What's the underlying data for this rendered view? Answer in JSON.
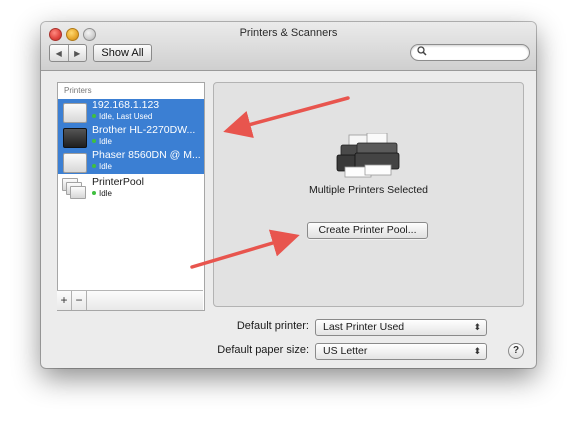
{
  "window": {
    "title": "Printers & Scanners"
  },
  "toolbar": {
    "back_glyph": "◀",
    "forward_glyph": "▶",
    "show_all_label": "Show All",
    "search_placeholder": "",
    "search_icon_glyph": "⚲"
  },
  "sidebar": {
    "header": "Printers",
    "printers": [
      {
        "name": "192.168.1.123",
        "status": "Idle, Last Used",
        "icon": "laser-printer-white",
        "selected": true
      },
      {
        "name": "Brother HL-2270DW...",
        "status": "Idle",
        "icon": "laser-printer-black",
        "selected": true
      },
      {
        "name": "Phaser 8560DN @ M...",
        "status": "Idle",
        "icon": "laser-printer-white",
        "selected": true
      },
      {
        "name": "PrinterPool",
        "status": "Idle",
        "icon": "printer-pool",
        "selected": false
      }
    ],
    "add_label": "+",
    "remove_label": "−"
  },
  "detail": {
    "icon": "multiple-printers-icon",
    "message": "Multiple Printers Selected",
    "create_pool_label": "Create Printer Pool..."
  },
  "settings": {
    "default_printer_label": "Default printer:",
    "default_printer_value": "Last Printer Used",
    "default_paper_label": "Default paper size:",
    "default_paper_value": "US Letter",
    "popup_chevron": "⬍",
    "help_label": "?"
  },
  "colors": {
    "selection": "#3b7fd3",
    "annotation_arrow": "#e8554e",
    "status_idle_dot": "#3fbf3f"
  }
}
